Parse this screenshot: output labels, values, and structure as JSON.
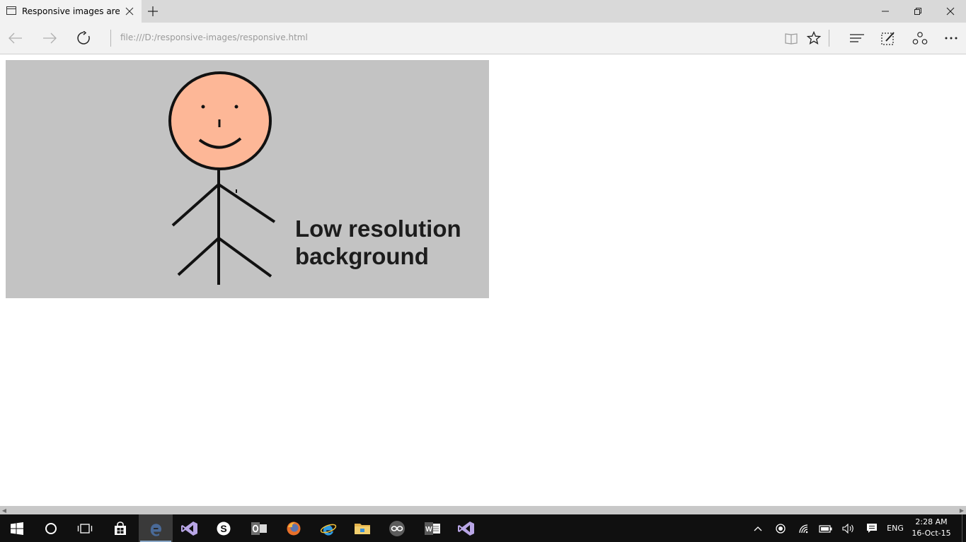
{
  "browser": {
    "tab_title": "Responsive images are f",
    "address": "file:///D:/responsive-images/responsive.html"
  },
  "page": {
    "hero_text_line1": "Low resolution",
    "hero_text_line2": "background"
  },
  "taskbar": {
    "language": "ENG",
    "time": "2:28 AM",
    "date": "16-Oct-15"
  },
  "colors": {
    "tab_strip": "#d9d9d9",
    "toolbar": "#f2f2f2",
    "hero_background": "#c3c3c3",
    "face": "#fdb797",
    "taskbar": "#101010"
  },
  "icons": {
    "title_bar": [
      "tab-page-icon",
      "close-tab-icon",
      "new-tab-icon",
      "minimize-icon",
      "restore-icon",
      "close-window-icon"
    ],
    "nav_bar": [
      "back-arrow-icon",
      "forward-arrow-icon",
      "refresh-icon",
      "reading-view-icon",
      "favorite-star-icon",
      "hub-icon",
      "web-note-icon",
      "share-icon",
      "more-icon"
    ],
    "taskbar": [
      "windows-start-icon",
      "cortana-icon",
      "task-view-icon",
      "store-icon",
      "edge-icon",
      "visual-studio-icon",
      "skype-icon",
      "outlook-icon",
      "firefox-icon",
      "internet-explorer-icon",
      "file-explorer-icon",
      "arduino-icon",
      "word-icon",
      "visual-studio-icon"
    ],
    "tray": [
      "chevron-up-icon",
      "record-icon",
      "wifi-icon",
      "battery-icon",
      "volume-icon",
      "action-center-icon"
    ]
  }
}
